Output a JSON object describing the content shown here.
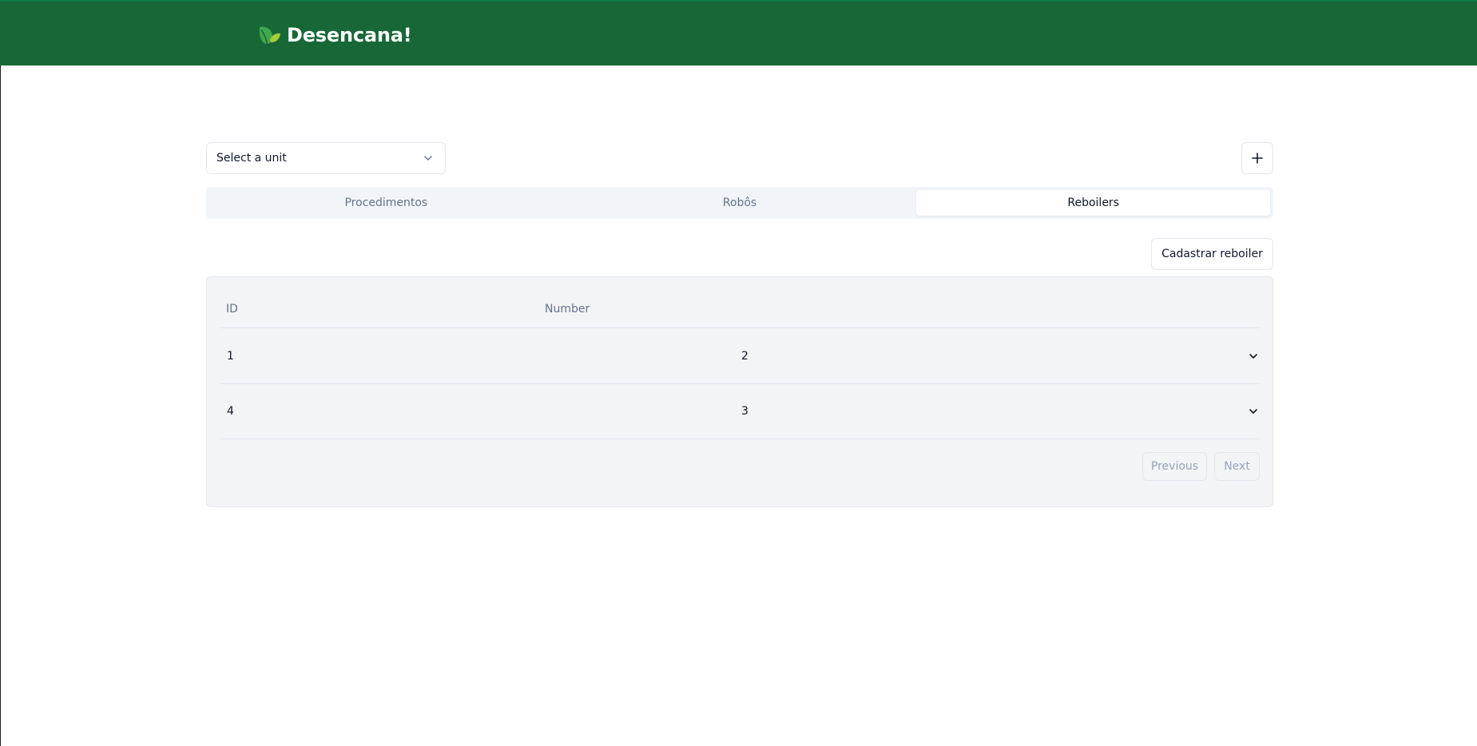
{
  "header": {
    "app_name": "Desencana!",
    "brand_color": "#186837",
    "logo_icon": "leaf-icon"
  },
  "toolbar": {
    "unit_select_placeholder": "Select a unit",
    "add_icon": "plus-icon"
  },
  "tabs": [
    {
      "label": "Procedimentos",
      "active": false
    },
    {
      "label": "Robôs",
      "active": false
    },
    {
      "label": "Reboilers",
      "active": true
    }
  ],
  "actions": {
    "register_label": "Cadastrar reboiler"
  },
  "table": {
    "columns": [
      "ID",
      "Number"
    ],
    "rows": [
      {
        "id": "1",
        "number": "2"
      },
      {
        "id": "4",
        "number": "3"
      }
    ],
    "row_action_icon": "chevron-down-icon"
  },
  "pagination": {
    "previous_label": "Previous",
    "next_label": "Next"
  }
}
